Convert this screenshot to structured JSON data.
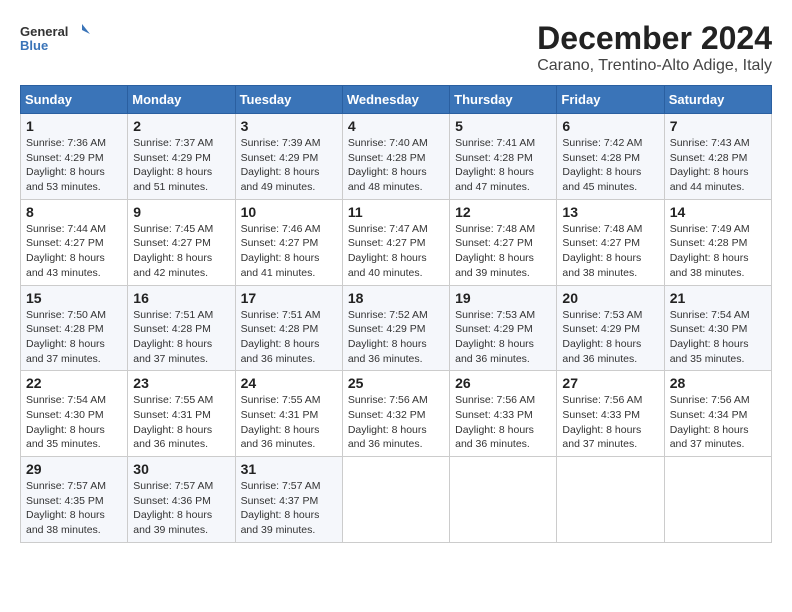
{
  "header": {
    "logo_line1": "General",
    "logo_line2": "Blue",
    "month": "December 2024",
    "location": "Carano, Trentino-Alto Adige, Italy"
  },
  "days_of_week": [
    "Sunday",
    "Monday",
    "Tuesday",
    "Wednesday",
    "Thursday",
    "Friday",
    "Saturday"
  ],
  "weeks": [
    [
      {
        "day": "1",
        "info": "Sunrise: 7:36 AM\nSunset: 4:29 PM\nDaylight: 8 hours\nand 53 minutes."
      },
      {
        "day": "2",
        "info": "Sunrise: 7:37 AM\nSunset: 4:29 PM\nDaylight: 8 hours\nand 51 minutes."
      },
      {
        "day": "3",
        "info": "Sunrise: 7:39 AM\nSunset: 4:29 PM\nDaylight: 8 hours\nand 49 minutes."
      },
      {
        "day": "4",
        "info": "Sunrise: 7:40 AM\nSunset: 4:28 PM\nDaylight: 8 hours\nand 48 minutes."
      },
      {
        "day": "5",
        "info": "Sunrise: 7:41 AM\nSunset: 4:28 PM\nDaylight: 8 hours\nand 47 minutes."
      },
      {
        "day": "6",
        "info": "Sunrise: 7:42 AM\nSunset: 4:28 PM\nDaylight: 8 hours\nand 45 minutes."
      },
      {
        "day": "7",
        "info": "Sunrise: 7:43 AM\nSunset: 4:28 PM\nDaylight: 8 hours\nand 44 minutes."
      }
    ],
    [
      {
        "day": "8",
        "info": "Sunrise: 7:44 AM\nSunset: 4:27 PM\nDaylight: 8 hours\nand 43 minutes."
      },
      {
        "day": "9",
        "info": "Sunrise: 7:45 AM\nSunset: 4:27 PM\nDaylight: 8 hours\nand 42 minutes."
      },
      {
        "day": "10",
        "info": "Sunrise: 7:46 AM\nSunset: 4:27 PM\nDaylight: 8 hours\nand 41 minutes."
      },
      {
        "day": "11",
        "info": "Sunrise: 7:47 AM\nSunset: 4:27 PM\nDaylight: 8 hours\nand 40 minutes."
      },
      {
        "day": "12",
        "info": "Sunrise: 7:48 AM\nSunset: 4:27 PM\nDaylight: 8 hours\nand 39 minutes."
      },
      {
        "day": "13",
        "info": "Sunrise: 7:48 AM\nSunset: 4:27 PM\nDaylight: 8 hours\nand 38 minutes."
      },
      {
        "day": "14",
        "info": "Sunrise: 7:49 AM\nSunset: 4:28 PM\nDaylight: 8 hours\nand 38 minutes."
      }
    ],
    [
      {
        "day": "15",
        "info": "Sunrise: 7:50 AM\nSunset: 4:28 PM\nDaylight: 8 hours\nand 37 minutes."
      },
      {
        "day": "16",
        "info": "Sunrise: 7:51 AM\nSunset: 4:28 PM\nDaylight: 8 hours\nand 37 minutes."
      },
      {
        "day": "17",
        "info": "Sunrise: 7:51 AM\nSunset: 4:28 PM\nDaylight: 8 hours\nand 36 minutes."
      },
      {
        "day": "18",
        "info": "Sunrise: 7:52 AM\nSunset: 4:29 PM\nDaylight: 8 hours\nand 36 minutes."
      },
      {
        "day": "19",
        "info": "Sunrise: 7:53 AM\nSunset: 4:29 PM\nDaylight: 8 hours\nand 36 minutes."
      },
      {
        "day": "20",
        "info": "Sunrise: 7:53 AM\nSunset: 4:29 PM\nDaylight: 8 hours\nand 36 minutes."
      },
      {
        "day": "21",
        "info": "Sunrise: 7:54 AM\nSunset: 4:30 PM\nDaylight: 8 hours\nand 35 minutes."
      }
    ],
    [
      {
        "day": "22",
        "info": "Sunrise: 7:54 AM\nSunset: 4:30 PM\nDaylight: 8 hours\nand 35 minutes."
      },
      {
        "day": "23",
        "info": "Sunrise: 7:55 AM\nSunset: 4:31 PM\nDaylight: 8 hours\nand 36 minutes."
      },
      {
        "day": "24",
        "info": "Sunrise: 7:55 AM\nSunset: 4:31 PM\nDaylight: 8 hours\nand 36 minutes."
      },
      {
        "day": "25",
        "info": "Sunrise: 7:56 AM\nSunset: 4:32 PM\nDaylight: 8 hours\nand 36 minutes."
      },
      {
        "day": "26",
        "info": "Sunrise: 7:56 AM\nSunset: 4:33 PM\nDaylight: 8 hours\nand 36 minutes."
      },
      {
        "day": "27",
        "info": "Sunrise: 7:56 AM\nSunset: 4:33 PM\nDaylight: 8 hours\nand 37 minutes."
      },
      {
        "day": "28",
        "info": "Sunrise: 7:56 AM\nSunset: 4:34 PM\nDaylight: 8 hours\nand 37 minutes."
      }
    ],
    [
      {
        "day": "29",
        "info": "Sunrise: 7:57 AM\nSunset: 4:35 PM\nDaylight: 8 hours\nand 38 minutes."
      },
      {
        "day": "30",
        "info": "Sunrise: 7:57 AM\nSunset: 4:36 PM\nDaylight: 8 hours\nand 39 minutes."
      },
      {
        "day": "31",
        "info": "Sunrise: 7:57 AM\nSunset: 4:37 PM\nDaylight: 8 hours\nand 39 minutes."
      },
      {
        "day": "",
        "info": ""
      },
      {
        "day": "",
        "info": ""
      },
      {
        "day": "",
        "info": ""
      },
      {
        "day": "",
        "info": ""
      }
    ]
  ]
}
